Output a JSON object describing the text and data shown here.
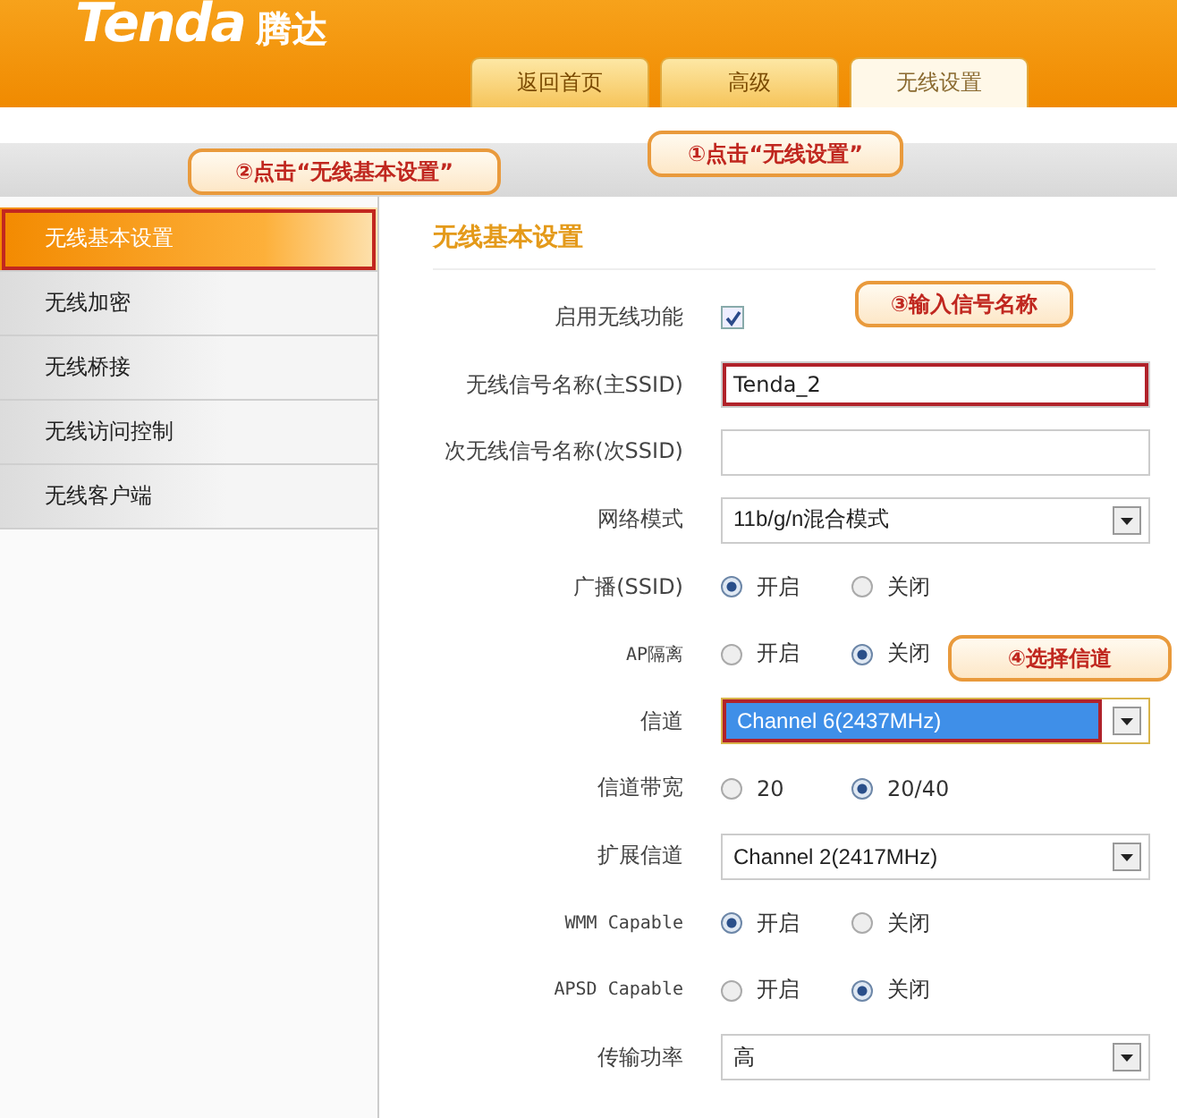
{
  "header": {
    "logo": "Tenda",
    "logo_cn": "腾达",
    "tabs": [
      {
        "label": "返回首页",
        "selected": false
      },
      {
        "label": "高级",
        "selected": false
      },
      {
        "label": "无线设置",
        "selected": true
      }
    ]
  },
  "annotations": [
    {
      "text": "①点击“无线设置”"
    },
    {
      "text": "②点击“无线基本设置”"
    },
    {
      "text": "③输入信号名称"
    },
    {
      "text": "④选择信道"
    }
  ],
  "sidebar": {
    "items": [
      {
        "label": "无线基本设置",
        "selected": true
      },
      {
        "label": "无线加密",
        "selected": false
      },
      {
        "label": "无线桥接",
        "selected": false
      },
      {
        "label": "无线访问控制",
        "selected": false
      },
      {
        "label": "无线客户端",
        "selected": false
      }
    ]
  },
  "form": {
    "title": "无线基本设置",
    "rows": [
      {
        "kind": "checkbox",
        "label": "启用无线功能",
        "checked": true
      },
      {
        "kind": "text",
        "label": "无线信号名称(主SSID)",
        "value": "Tenda_2",
        "highlighted": true
      },
      {
        "kind": "text",
        "label": "次无线信号名称(次SSID)",
        "highlighted": false
      },
      {
        "kind": "select",
        "label": "网络模式",
        "value": "11b/g/n混合模式",
        "highlighted": false
      },
      {
        "kind": "radio",
        "label": "广播(SSID)",
        "options": [
          {
            "label": "开启",
            "selected": true
          },
          {
            "label": "关闭",
            "selected": false
          }
        ]
      },
      {
        "kind": "radio",
        "label": "AP隔离",
        "options": [
          {
            "label": "开启",
            "selected": false
          },
          {
            "label": "关闭",
            "selected": true
          }
        ]
      },
      {
        "kind": "select",
        "label": "信道",
        "value": "Channel 6(2437MHz)",
        "highlighted": true
      },
      {
        "kind": "radio",
        "label": "信道带宽",
        "options": [
          {
            "label": "20",
            "selected": false
          },
          {
            "label": "20/40",
            "selected": true
          }
        ]
      },
      {
        "kind": "select",
        "label": "扩展信道",
        "value": "Channel 2(2417MHz)",
        "highlighted": false
      },
      {
        "kind": "radio",
        "label": "WMM Capable",
        "options": [
          {
            "label": "开启",
            "selected": true
          },
          {
            "label": "关闭",
            "selected": false
          }
        ]
      },
      {
        "kind": "radio",
        "label": "APSD Capable",
        "options": [
          {
            "label": "开启",
            "selected": false
          },
          {
            "label": "关闭",
            "selected": true
          }
        ]
      },
      {
        "kind": "select",
        "label": "传输功率",
        "value": "高",
        "highlighted": false
      }
    ]
  }
}
